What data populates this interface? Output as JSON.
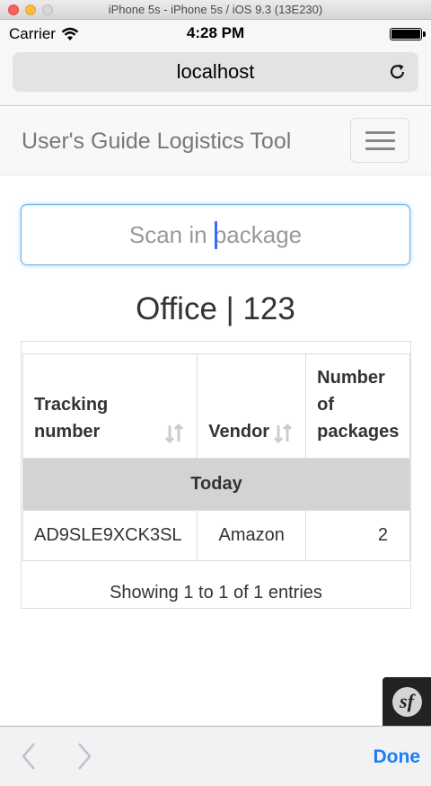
{
  "simulator": {
    "title": "iPhone 5s - iPhone 5s / iOS 9.3 (13E230)"
  },
  "status_bar": {
    "carrier": "Carrier",
    "time": "4:28 PM"
  },
  "browser": {
    "url": "localhost"
  },
  "navbar": {
    "brand": "User's Guide Logistics Tool"
  },
  "scan": {
    "placeholder": "Scan in package",
    "value": ""
  },
  "page": {
    "heading": "Office | 123"
  },
  "table": {
    "columns": [
      "Tracking number",
      "Vendor",
      "Number of packages"
    ],
    "column_lines": [
      [
        "Tracking",
        "number"
      ],
      [
        "Vendor"
      ],
      [
        "Number",
        "of",
        "packages"
      ]
    ],
    "group_label": "Today",
    "rows": [
      {
        "tracking_number": "AD9SLE9XCK3SL",
        "vendor": "Amazon",
        "packages": "2"
      }
    ],
    "info": "Showing 1 to 1 of 1 entries"
  },
  "toolbar": {
    "done_label": "Done"
  },
  "icons": {
    "wifi": "wifi-icon",
    "battery": "battery-icon",
    "reload": "reload-icon",
    "menu": "hamburger-menu-icon",
    "sort": "sort-icon",
    "symfony": "symfony-icon",
    "back": "chevron-left-icon",
    "forward": "chevron-right-icon"
  },
  "colors": {
    "accent": "#1b7ef7",
    "focus": "#66afe9",
    "group_bg": "#d3d3d3",
    "caret": "#3a6cf2"
  }
}
